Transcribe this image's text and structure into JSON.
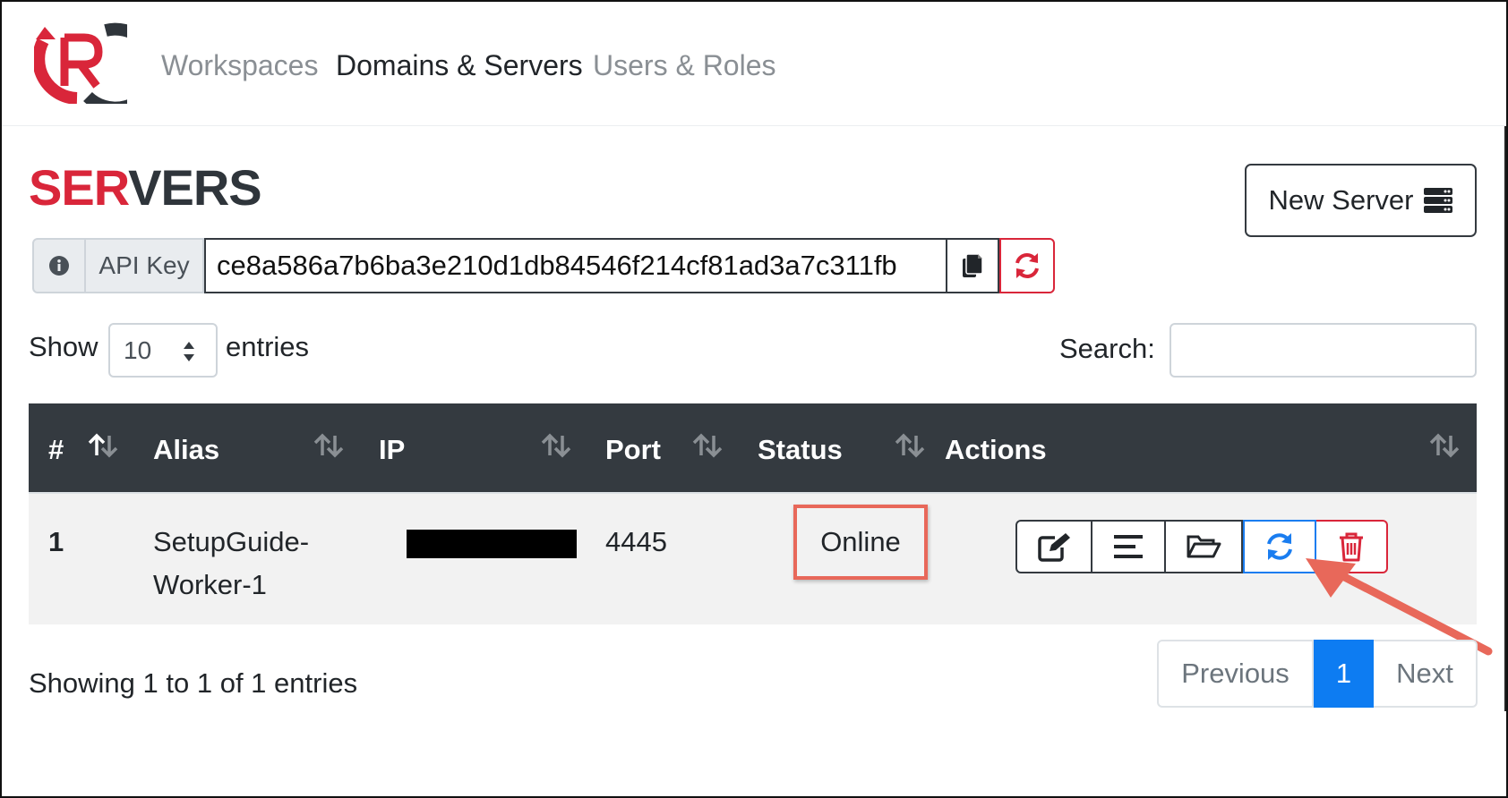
{
  "nav": {
    "items": [
      {
        "label": "Workspaces"
      },
      {
        "label": "Domains & Servers"
      },
      {
        "label": "Users & Roles"
      }
    ]
  },
  "page": {
    "title_red": "SER",
    "title_dark": "VERS",
    "new_server_label": "New Server"
  },
  "api": {
    "label": "API Key",
    "value": "ce8a586a7b6ba3e210d1db84546f214cf81ad3a7c311fb"
  },
  "length_menu": {
    "show_label": "Show",
    "selected": "10",
    "entries_label": "entries"
  },
  "search": {
    "label": "Search:",
    "value": ""
  },
  "table": {
    "columns": [
      "#",
      "Alias",
      "IP",
      "Port",
      "Status",
      "Actions"
    ],
    "rows": [
      {
        "num": "1",
        "alias_line1": "SetupGuide-",
        "alias_line2": "Worker-1",
        "port": "4445",
        "status": "Online"
      }
    ]
  },
  "footer": {
    "info": "Showing 1 to 1 of 1 entries",
    "prev": "Previous",
    "page": "1",
    "next": "Next"
  },
  "colors": {
    "brand_red": "#d9263a",
    "header_dark": "#343a40",
    "primary_blue": "#0d7cf2",
    "annotation": "#e8685a"
  },
  "icons": [
    "logo",
    "info-icon",
    "copy-icon",
    "refresh-icon",
    "server-icon",
    "sort-icon",
    "edit-icon",
    "list-icon",
    "folder-open-icon",
    "sync-icon",
    "trash-icon",
    "arrow-annotation"
  ]
}
